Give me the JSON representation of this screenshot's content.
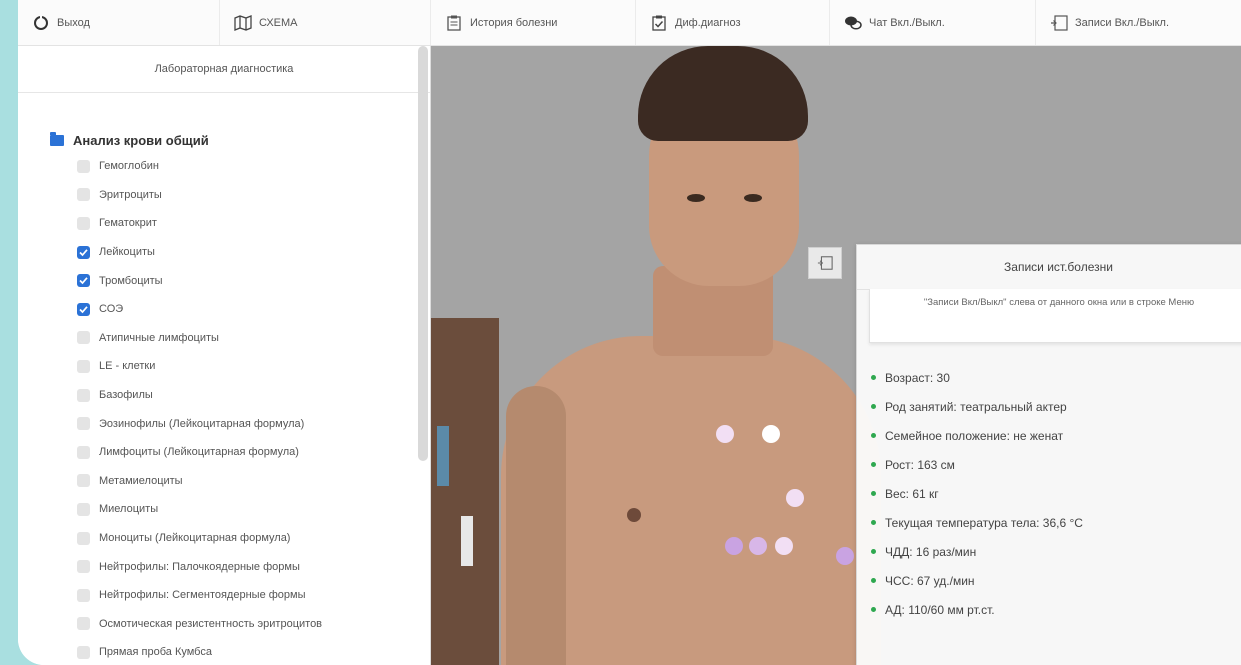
{
  "toolbar": {
    "items": [
      {
        "label": "Выход",
        "icon": "exit-icon"
      },
      {
        "label": "СХЕМА",
        "icon": "map-icon"
      },
      {
        "label": "История болезни",
        "icon": "clipboard-icon"
      },
      {
        "label": "Диф.диагноз",
        "icon": "checklist-icon"
      },
      {
        "label": "Чат Вкл./Выкл.",
        "icon": "chat-icon"
      },
      {
        "label": "Записи Вкл./Выкл.",
        "icon": "notes-toggle-icon"
      }
    ]
  },
  "left_panel": {
    "title": "Лабораторная диагностика",
    "group_label": "Анализ крови общий",
    "items": [
      {
        "label": "Гемоглобин",
        "checked": false
      },
      {
        "label": "Эритроциты",
        "checked": false
      },
      {
        "label": "Гематокрит",
        "checked": false
      },
      {
        "label": "Лейкоциты",
        "checked": true
      },
      {
        "label": "Тромбоциты",
        "checked": true
      },
      {
        "label": "СОЭ",
        "checked": true
      },
      {
        "label": "Атипичные лимфоциты",
        "checked": false
      },
      {
        "label": "LE - клетки",
        "checked": false
      },
      {
        "label": "Базофилы",
        "checked": false
      },
      {
        "label": "Эозинофилы (Лейкоцитарная формула)",
        "checked": false
      },
      {
        "label": "Лимфоциты (Лейкоцитарная формула)",
        "checked": false
      },
      {
        "label": "Метамиелоциты",
        "checked": false
      },
      {
        "label": "Миелоциты",
        "checked": false
      },
      {
        "label": "Моноциты (Лейкоцитарная формула)",
        "checked": false
      },
      {
        "label": "Нейтрофилы: Палочкоядерные формы",
        "checked": false
      },
      {
        "label": "Нейтрофилы: Сегментоядерные формы",
        "checked": false
      },
      {
        "label": "Осмотическая резистентность эритроцитов",
        "checked": false
      },
      {
        "label": "Прямая проба Кумбса",
        "checked": false
      }
    ]
  },
  "records": {
    "title": "Записи ист.болезни",
    "hint": "\"Записи Вкл/Выкл\" слева от данного окна или в строке Меню",
    "items": [
      "Возраст: 30",
      "Род занятий: театральный актер",
      "Семейное положение: не женат",
      "Рост: 163 см",
      "Вес: 61 кг",
      "Текущая температура тела: 36,6 °С",
      "ЧДД: 16 раз/мин",
      "ЧСС: 67 уд./мин",
      "АД: 110/60 мм рт.ст."
    ]
  },
  "colors": {
    "accent": "#2b72d6",
    "bullet": "#2fa84f",
    "background": "#a9dfe0",
    "auscultation_point_light": "#f2dff4",
    "auscultation_point_dark": "#c9a3e2"
  }
}
